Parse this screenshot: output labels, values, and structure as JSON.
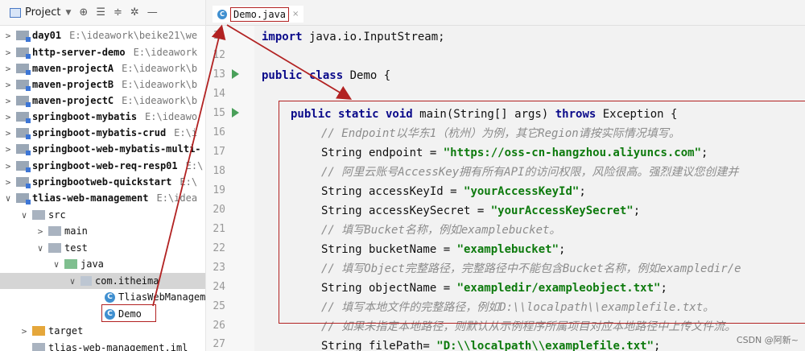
{
  "project_panel": {
    "title": "Project",
    "tree": [
      {
        "name": "day01",
        "path": "E:\\ideawork\\beike21\\we",
        "kind": "module",
        "arrow": ">"
      },
      {
        "name": "http-server-demo",
        "path": "E:\\ideawork",
        "kind": "module",
        "arrow": ">"
      },
      {
        "name": "maven-projectA",
        "path": "E:\\ideawork\\b",
        "kind": "module",
        "arrow": ">"
      },
      {
        "name": "maven-projectB",
        "path": "E:\\ideawork\\b",
        "kind": "module",
        "arrow": ">"
      },
      {
        "name": "maven-projectC",
        "path": "E:\\ideawork\\b",
        "kind": "module",
        "arrow": ">"
      },
      {
        "name": "springboot-mybatis",
        "path": "E:\\ideawo",
        "kind": "module",
        "arrow": ">"
      },
      {
        "name": "springboot-mybatis-crud",
        "path": "E:\\i",
        "kind": "module",
        "arrow": ">"
      },
      {
        "name": "springboot-web-mybatis-multi-",
        "path": "",
        "kind": "module",
        "arrow": ">"
      },
      {
        "name": "springboot-web-req-resp01",
        "path": "E:\\",
        "kind": "module",
        "arrow": ">"
      },
      {
        "name": "springbootweb-quickstart",
        "path": "E:\\",
        "kind": "module",
        "arrow": ">"
      },
      {
        "name": "tlias-web-management",
        "path": "E:\\idea",
        "kind": "module",
        "arrow": "∨"
      },
      {
        "name": "src",
        "path": "",
        "kind": "plain",
        "arrow": "∨"
      },
      {
        "name": "main",
        "path": "",
        "kind": "plain",
        "arrow": ">"
      },
      {
        "name": "test",
        "path": "",
        "kind": "plain",
        "arrow": "∨"
      },
      {
        "name": "java",
        "path": "",
        "kind": "test",
        "arrow": "∨"
      },
      {
        "name": "com.itheima",
        "path": "",
        "kind": "pkg",
        "arrow": "∨"
      },
      {
        "name": "TliasWebManagem",
        "path": "",
        "kind": "class",
        "arrow": ""
      },
      {
        "name": "Demo",
        "path": "",
        "kind": "class",
        "arrow": ""
      },
      {
        "name": "target",
        "path": "",
        "kind": "target",
        "arrow": ">"
      },
      {
        "name": "tlias-web-management.iml",
        "path": "",
        "kind": "file",
        "arrow": ""
      }
    ]
  },
  "editor": {
    "tab_label": "Demo.java",
    "line_numbers": [
      "11",
      "12",
      "13",
      "14",
      "15",
      "16",
      "17",
      "18",
      "19",
      "20",
      "21",
      "22",
      "23",
      "24",
      "25",
      "26",
      "27"
    ],
    "code": {
      "l11_kw": "import",
      "l11_rest": " java.io.InputStream;",
      "l13_kw": "public class",
      "l13_rest": " Demo {",
      "l15_kw1": "public static void",
      "l15_mid": " main(String[] args) ",
      "l15_kw2": "throws",
      "l15_rest": " Exception {",
      "l16": "// Endpoint以华东1（杭州）为例，其它Region请按实际情况填写。",
      "l17_a": "String endpoint = ",
      "l17_s": "\"https://oss-cn-hangzhou.aliyuncs.com\"",
      "l17_b": ";",
      "l18": "// 阿里云账号AccessKey拥有所有API的访问权限，风险很高。强烈建议您创建并",
      "l19_a": "String accessKeyId = ",
      "l19_s": "\"yourAccessKeyId\"",
      "l19_b": ";",
      "l20_a": "String accessKeySecret = ",
      "l20_s": "\"yourAccessKeySecret\"",
      "l20_b": ";",
      "l21": "// 填写Bucket名称，例如examplebucket。",
      "l22_a": "String bucketName = ",
      "l22_s": "\"examplebucket\"",
      "l22_b": ";",
      "l23": "// 填写Object完整路径，完整路径中不能包含Bucket名称，例如exampledir/e",
      "l24_a": "String objectName = ",
      "l24_s": "\"exampledir/exampleobject.txt\"",
      "l24_b": ";",
      "l25": "// 填写本地文件的完整路径，例如D:\\\\localpath\\\\examplefile.txt。",
      "l26": "// 如果未指定本地路径，则默认从示例程序所属项目对应本地路径中上传文件流。",
      "l27_a": "String filePath= ",
      "l27_s": "\"D:\\\\localpath\\\\examplefile.txt\"",
      "l27_b": ";"
    }
  },
  "watermark": "CSDN @阿新~",
  "colors": {
    "annotation": "#b22222",
    "keyword": "#0a0a8a",
    "string": "#0d7a0d",
    "comment": "#8c8c8c",
    "run": "#4aa05a"
  }
}
